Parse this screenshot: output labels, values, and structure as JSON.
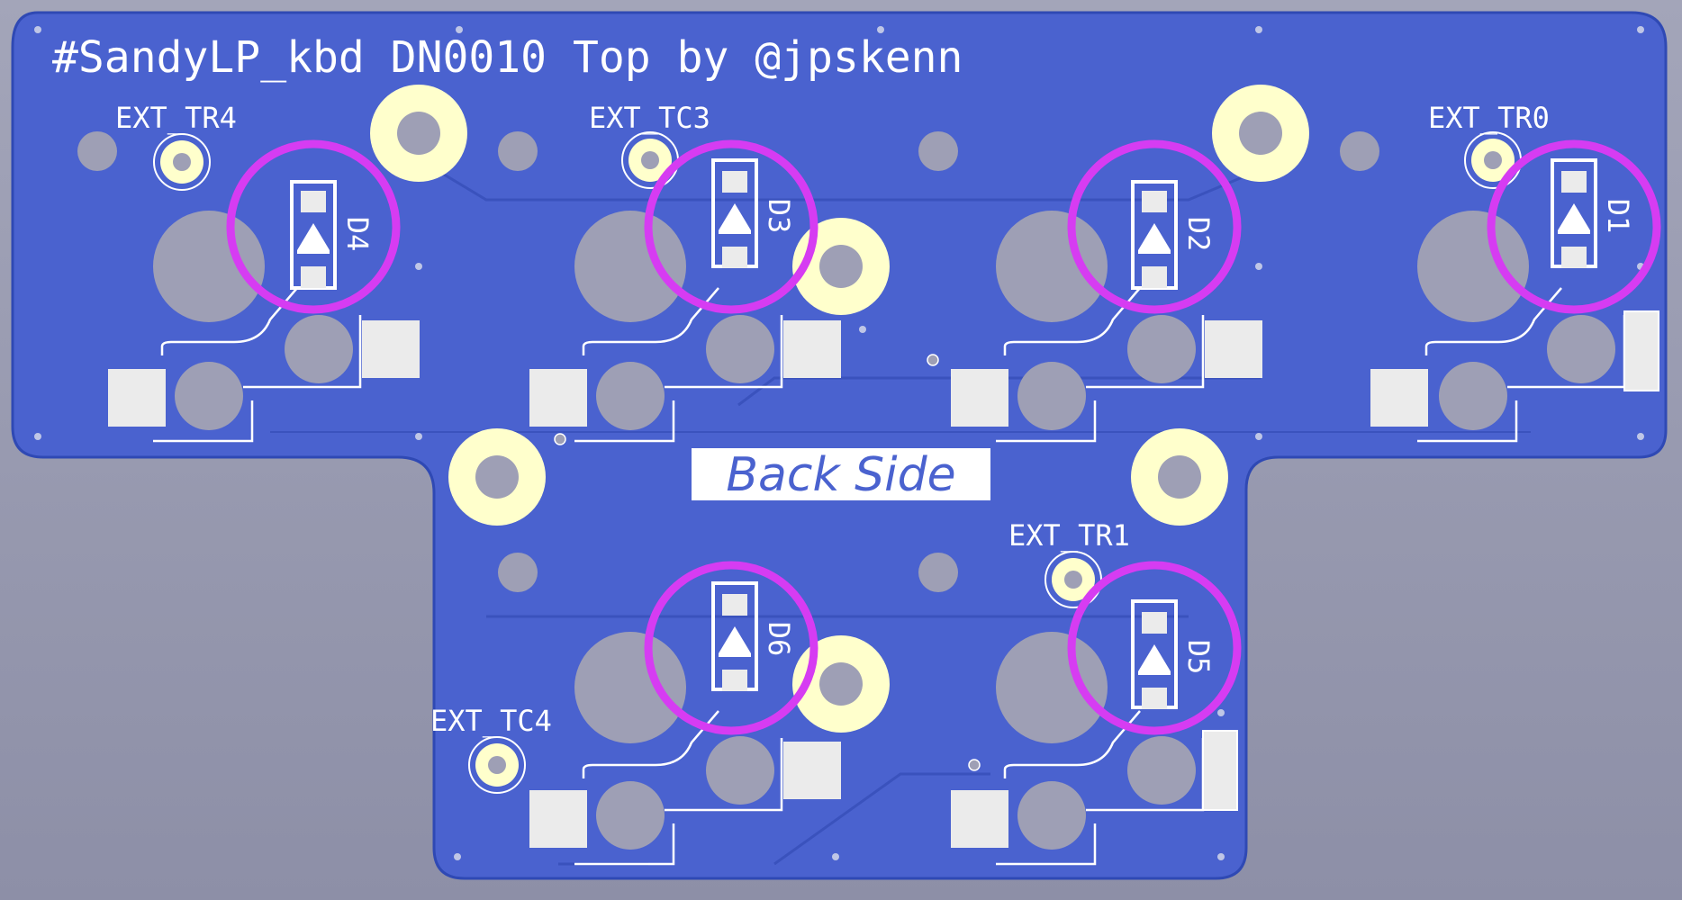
{
  "pcb": {
    "title": "#SandyLP_kbd DN0010 Top by @jpskenn",
    "back_side_label": "Back Side",
    "colors": {
      "background": "#9899b0",
      "copper_fill": "#4a62cf",
      "board_outline": "#2f49b4",
      "silkscreen": "#ffffff",
      "pads": "#ffffcc",
      "holes": "#9e9fb5",
      "highlight_ring": "#d63cf2"
    },
    "ext_labels": [
      "EXT_TR4",
      "EXT_TC3",
      "EXT_TR0",
      "EXT_TR1",
      "EXT_TC4"
    ],
    "diodes": [
      "D4",
      "D3",
      "D2",
      "D1",
      "D6",
      "D5"
    ]
  }
}
